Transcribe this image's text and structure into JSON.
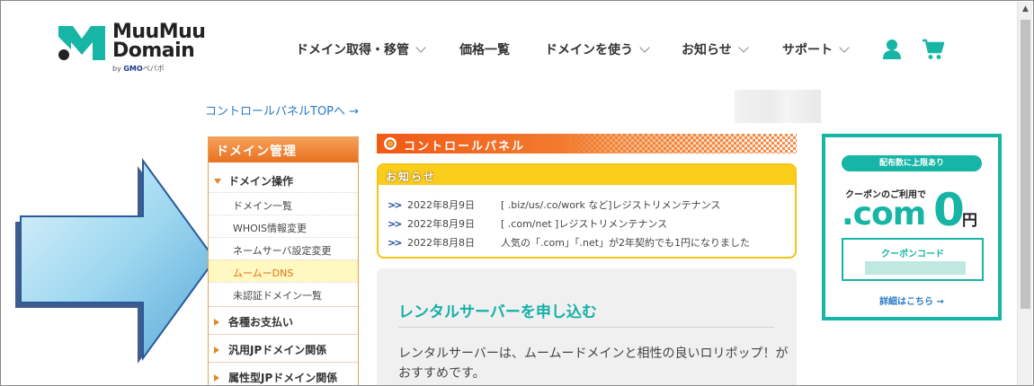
{
  "logo": {
    "line1": "MuuMuu",
    "line2": "Domain",
    "by_prefix": "by ",
    "by_brand": "GMO",
    "by_suffix": "ペパボ"
  },
  "nav": [
    {
      "label": "ドメイン取得・移管",
      "has_menu": true
    },
    {
      "label": "価格一覧",
      "has_menu": false
    },
    {
      "label": "ドメインを使う",
      "has_menu": true
    },
    {
      "label": "お知らせ",
      "has_menu": true
    },
    {
      "label": "サポート",
      "has_menu": true
    }
  ],
  "header_icons": {
    "user": "user-icon",
    "cart": "cart-icon"
  },
  "cp_link": "コントロールパネルTOPへ →",
  "sidebar": {
    "title": "ドメイン管理",
    "section": "ドメイン操作",
    "items": [
      "ドメイン一覧",
      "WHOIS情報変更",
      "ネームサーバ設定変更",
      "ムームーDNS",
      "未認証ドメイン一覧"
    ],
    "active_item": "ムームーDNS",
    "categories": [
      "各種お支払い",
      "汎用JPドメイン関係",
      "属性型JPドメイン関係"
    ]
  },
  "control_panel_banner": "コントロールパネル",
  "news": {
    "title": "お知らせ",
    "items": [
      {
        "date": "2022年8月9日",
        "text": "[ .biz/us/.co/work など]レジストリメンテナンス"
      },
      {
        "date": "2022年8月9日",
        "text": "[ .com/net ]レジストリメンテナンス"
      },
      {
        "date": "2022年8月8日",
        "text": "人気の「.com」「.net」が2年契約でも1円になりました"
      }
    ]
  },
  "rental": {
    "title": "レンタルサーバーを申し込む",
    "body": "レンタルサーバーは、ムームードメインと相性の良いロリポップ！がおすすめです。"
  },
  "coupon": {
    "pill": "配布数に上限あり",
    "sub": "クーポンのご利用で",
    "domain": ".com",
    "price": "0",
    "yen": "円",
    "code_label": "クーポンコード",
    "detail": "詳細はこちら →"
  },
  "colors": {
    "teal": "#17b5a5",
    "orange": "#f05a16",
    "yellow": "#fbcd1b",
    "link": "#2a7bc4"
  }
}
